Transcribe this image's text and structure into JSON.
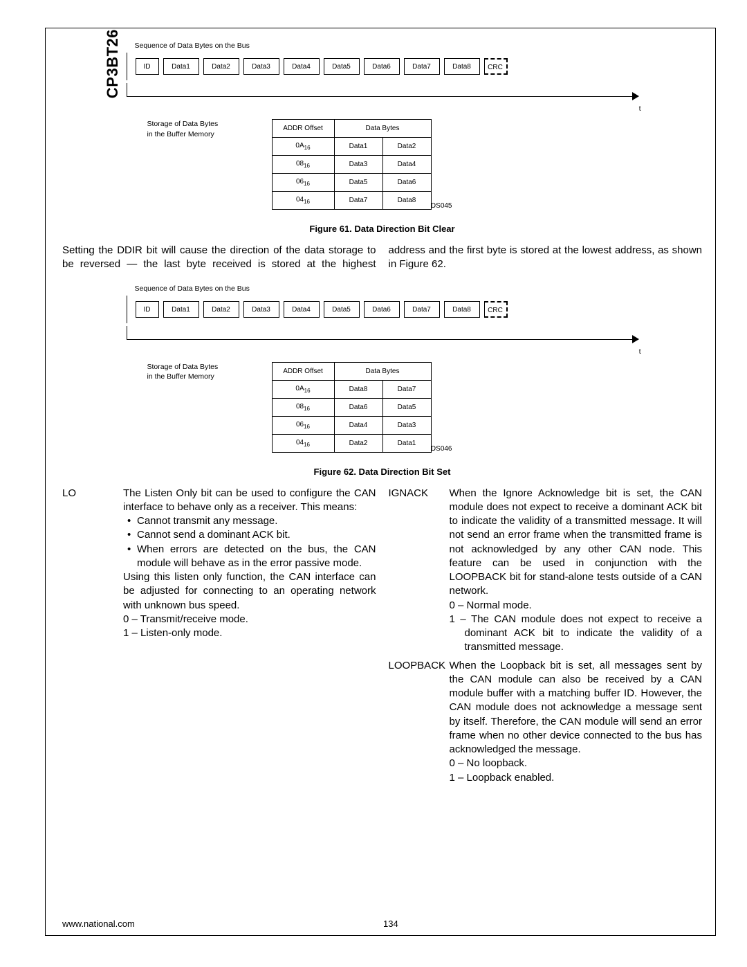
{
  "chip": "CP3BT26",
  "fig61": {
    "seq_title": "Sequence of Data Bytes on the Bus",
    "id": "ID",
    "data": [
      "Data1",
      "Data2",
      "Data3",
      "Data4",
      "Data5",
      "Data6",
      "Data7",
      "Data8"
    ],
    "crc": "CRC",
    "t": "t",
    "mem_label_l1": "Storage of Data Bytes",
    "mem_label_l2": "in the Buffer Memory",
    "header_addr": "ADDR Offset",
    "header_data": "Data Bytes",
    "rows": [
      {
        "addr": "0A",
        "sub": "16",
        "b1": "Data1",
        "b2": "Data2"
      },
      {
        "addr": "08",
        "sub": "16",
        "b1": "Data3",
        "b2": "Data4"
      },
      {
        "addr": "06",
        "sub": "16",
        "b1": "Data5",
        "b2": "Data6"
      },
      {
        "addr": "04",
        "sub": "16",
        "b1": "Data7",
        "b2": "Data8"
      }
    ],
    "ds": "DS045",
    "caption": "Figure 61.   Data Direction Bit Clear"
  },
  "para": "Setting the DDIR bit will cause the direction of the data storage to be reversed — the last byte received is stored at the highest address and the first byte is stored at the lowest address, as shown in Figure 62.",
  "fig62": {
    "seq_title": "Sequence of Data Bytes on the Bus",
    "id": "ID",
    "data": [
      "Data1",
      "Data2",
      "Data3",
      "Data4",
      "Data5",
      "Data6",
      "Data7",
      "Data8"
    ],
    "crc": "CRC",
    "t": "t",
    "mem_label_l1": "Storage of Data Bytes",
    "mem_label_l2": "in the Buffer Memory",
    "header_addr": "ADDR Offset",
    "header_data": "Data Bytes",
    "rows": [
      {
        "addr": "0A",
        "sub": "16",
        "b1": "Data8",
        "b2": "Data7"
      },
      {
        "addr": "08",
        "sub": "16",
        "b1": "Data6",
        "b2": "Data5"
      },
      {
        "addr": "06",
        "sub": "16",
        "b1": "Data4",
        "b2": "Data3"
      },
      {
        "addr": "04",
        "sub": "16",
        "b1": "Data2",
        "b2": "Data1"
      }
    ],
    "ds": "DS046",
    "caption": "Figure 62.   Data Direction Bit Set"
  },
  "defs": {
    "lo": {
      "term": "LO",
      "intro": "The Listen Only bit can be used to configure the CAN interface to behave only as a receiver. This means:",
      "bullets": [
        "Cannot transmit any message.",
        "Cannot send a dominant ACK bit.",
        "When errors are detected on the bus, the CAN module will behave as in the error passive mode."
      ],
      "outro": "Using this listen only function, the CAN interface can be adjusted for connecting to an operating network with unknown bus speed.",
      "m0": "0 – Transmit/receive mode.",
      "m1": "1 – Listen-only mode."
    },
    "ignack": {
      "term": "IGNACK",
      "body": "When the Ignore Acknowledge bit is set, the CAN module does not expect to receive a dominant ACK bit to indicate the validity of a transmitted message. It will not send an error frame when the transmitted frame is not acknowledged by any other CAN node. This feature can be used in conjunction with the LOOPBACK bit for stand-alone tests outside of a CAN network.",
      "m0": "0 – Normal mode.",
      "m1": "1 – The CAN module does not expect to receive a dominant ACK bit to indicate the validity of a transmitted message."
    },
    "loopback": {
      "term": "LOOPBACK",
      "body": "When the Loopback bit is set, all messages sent by the CAN module can also be received by a CAN module buffer with a matching buffer ID. However, the CAN module does not acknowledge a message sent by itself. Therefore, the CAN module will send an error frame when no other device connected to the bus has acknowledged the message.",
      "m0": "0 – No loopback.",
      "m1": "1 – Loopback enabled."
    }
  },
  "footer": {
    "url": "www.national.com",
    "page": "134"
  }
}
